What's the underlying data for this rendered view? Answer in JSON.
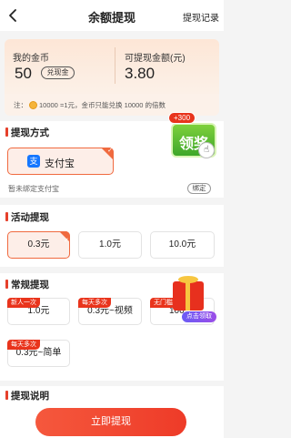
{
  "header": {
    "title": "余额提现",
    "record_label": "提现记录"
  },
  "balance": {
    "coin_label": "我的金币",
    "coin_value": "50",
    "exchange_label": "兑现金",
    "amount_label": "可提现金额(元)",
    "amount_value": "3.80",
    "note_prefix": "注：",
    "note_text": "10000 =1元，金币只能兑换 10000 的倍数"
  },
  "withdraw_method": {
    "title": "提现方式",
    "option_label": "支付宝",
    "unbound_text": "暂未绑定支付宝",
    "bind_label": "绑定"
  },
  "reward_float": {
    "plus_label": "+300",
    "text": "领奖"
  },
  "activity": {
    "title": "活动提现",
    "options": [
      {
        "label": "0.3元",
        "selected": true
      },
      {
        "label": "1.0元",
        "selected": false
      },
      {
        "label": "10.0元",
        "selected": false
      }
    ]
  },
  "regular": {
    "title": "常规提现",
    "options": [
      {
        "tag": "新人一次",
        "label": "1.0元"
      },
      {
        "tag": "每天多次",
        "label": "0.3元~视频"
      },
      {
        "tag": "无门槛",
        "label": "100"
      },
      {
        "tag": "每天多次",
        "label": "0.3元~简单"
      }
    ]
  },
  "gift_float": {
    "bubble_label": "点击领取"
  },
  "instructions": {
    "title": "提现说明"
  },
  "submit": {
    "label": "立即提现"
  },
  "colors": {
    "accent": "#ee3b28",
    "selected_bg": "#fdeee8",
    "alipay": "#1677ff"
  }
}
